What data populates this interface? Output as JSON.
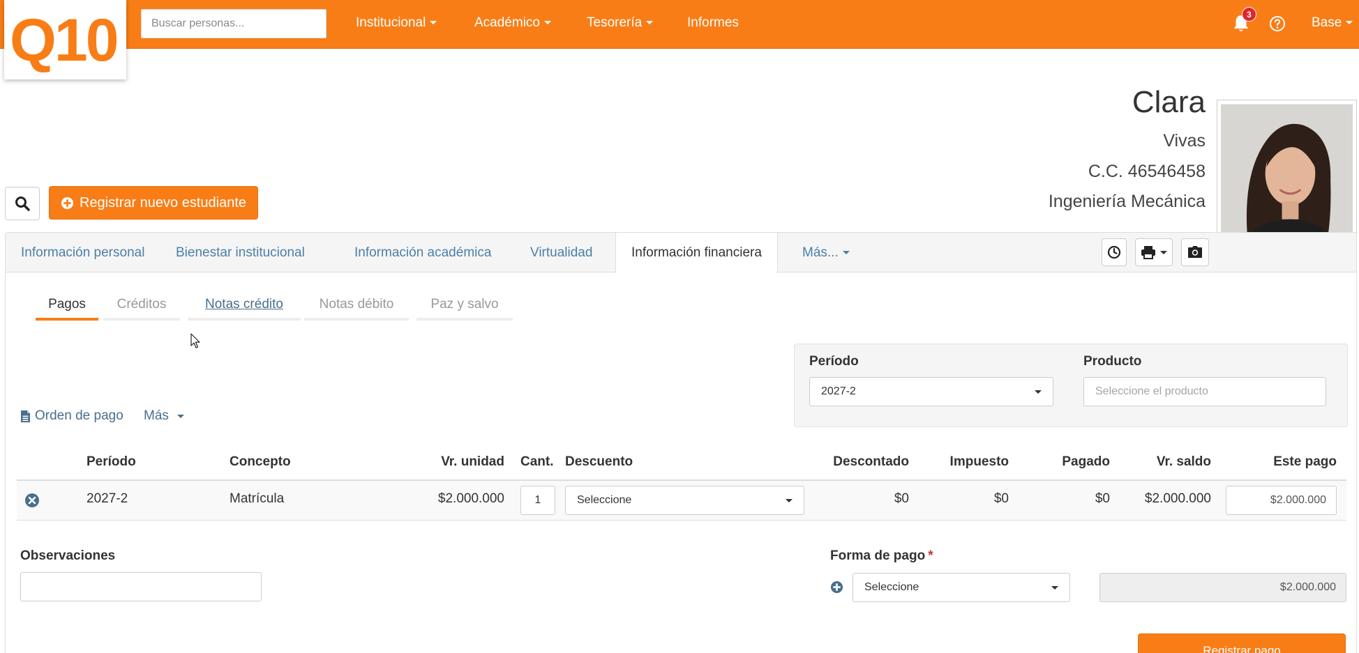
{
  "brand": {
    "logo_text": "Q10",
    "accent": "#f97d16",
    "link": "#4a7fa8"
  },
  "topnav": {
    "search_placeholder": "Buscar personas...",
    "items": [
      "Institucional",
      "Académico",
      "Tesorería",
      "Informes"
    ],
    "notification_count": "3",
    "user_label": "Base"
  },
  "student": {
    "first_name": "Clara",
    "last_name": "Vivas",
    "document": "C.C. 46546458",
    "program": "Ingeniería Mecánica"
  },
  "actions": {
    "new_student": "Registrar nuevo estudiante"
  },
  "tabs": [
    "Información personal",
    "Bienestar institucional",
    "Información académica",
    "Virtualidad",
    "Información financiera",
    "Más..."
  ],
  "subtabs": [
    "Pagos",
    "Créditos",
    "Notas crédito",
    "Notas débito",
    "Paz y salvo"
  ],
  "filters": {
    "period_label": "Período",
    "period_value": "2027-2",
    "product_label": "Producto",
    "product_placeholder": "Seleccione el producto"
  },
  "links": {
    "payment_order": "Orden de pago",
    "more": "Más"
  },
  "table": {
    "headers": [
      "Período",
      "Concepto",
      "Vr. unidad",
      "Cant.",
      "Descuento",
      "Descontado",
      "Impuesto",
      "Pagado",
      "Vr. saldo",
      "Este pago"
    ],
    "rows": [
      {
        "period": "2027-2",
        "concept": "Matrícula",
        "unit_value": "$2.000.000",
        "quantity": "1",
        "discount": "Seleccione",
        "discounted": "$0",
        "tax": "$0",
        "paid": "$0",
        "balance": "$2.000.000",
        "this_payment": "$2.000.000"
      }
    ]
  },
  "form": {
    "observations_label": "Observaciones",
    "payment_method_label": "Forma de pago",
    "payment_method_value": "Seleccione",
    "payment_total": "$2.000.000",
    "submit_label": "Registrar pago"
  }
}
